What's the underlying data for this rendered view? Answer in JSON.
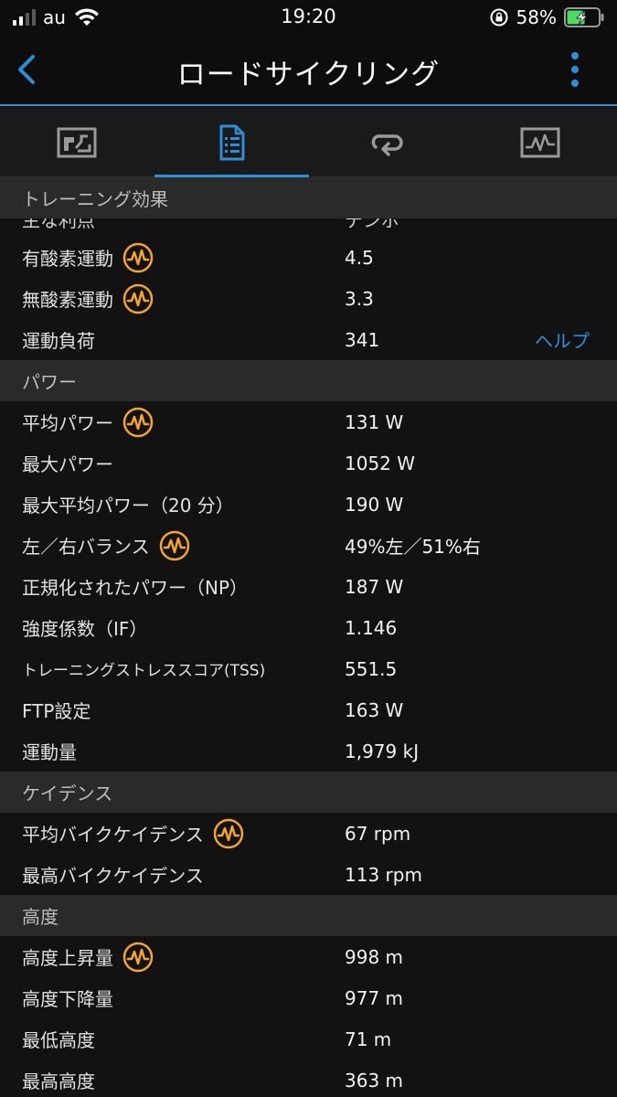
{
  "status": {
    "carrier": "au",
    "time": "19:20",
    "battery_percent": "58%",
    "battery_level": 0.58
  },
  "nav": {
    "title": "ロードサイクリング"
  },
  "tabs": [
    {
      "icon": "map-icon",
      "active": false
    },
    {
      "icon": "details-list-icon",
      "active": true
    },
    {
      "icon": "laps-icon",
      "active": false
    },
    {
      "icon": "chart-icon",
      "active": false
    }
  ],
  "colors": {
    "accent": "#2a90d8",
    "badge": "#f5a623",
    "section_bg": "#2a2a2a",
    "background": "#121212"
  },
  "sections": {
    "training": {
      "header": "トレーニング効果",
      "partial_label": "主な利点",
      "partial_value": "テンポ",
      "aerobic_label": "有酸素運動",
      "aerobic_value": "4.5",
      "anaerobic_label": "無酸素運動",
      "anaerobic_value": "3.3",
      "load_label": "運動負荷",
      "load_value": "341",
      "help": "ヘルプ"
    },
    "power": {
      "header": "パワー",
      "rows": [
        {
          "label": "平均パワー",
          "value": "131 W"
        },
        {
          "label": "最大パワー",
          "value": "1052 W"
        },
        {
          "label": "最大平均パワー（20 分）",
          "value": "190 W"
        },
        {
          "label": "左／右バランス",
          "value": "49%左／51%右"
        },
        {
          "label": "正規化されたパワー（NP）",
          "value": "187 W"
        },
        {
          "label": "強度係数（IF）",
          "value": "1.146"
        },
        {
          "label": "トレーニングストレススコア(TSS)",
          "value": "551.5"
        },
        {
          "label": "FTP設定",
          "value": "163 W"
        },
        {
          "label": "運動量",
          "value": "1,979 kJ"
        }
      ]
    },
    "cadence": {
      "header": "ケイデンス",
      "rows": [
        {
          "label": "平均バイクケイデンス",
          "value": "67 rpm"
        },
        {
          "label": "最高バイクケイデンス",
          "value": "113 rpm"
        }
      ]
    },
    "elevation": {
      "header": "高度",
      "rows": [
        {
          "label": "高度上昇量",
          "value": "998 m"
        },
        {
          "label": "高度下降量",
          "value": "977 m"
        },
        {
          "label": "最低高度",
          "value": "71 m"
        },
        {
          "label": "最高高度",
          "value": "363 m"
        }
      ]
    }
  }
}
